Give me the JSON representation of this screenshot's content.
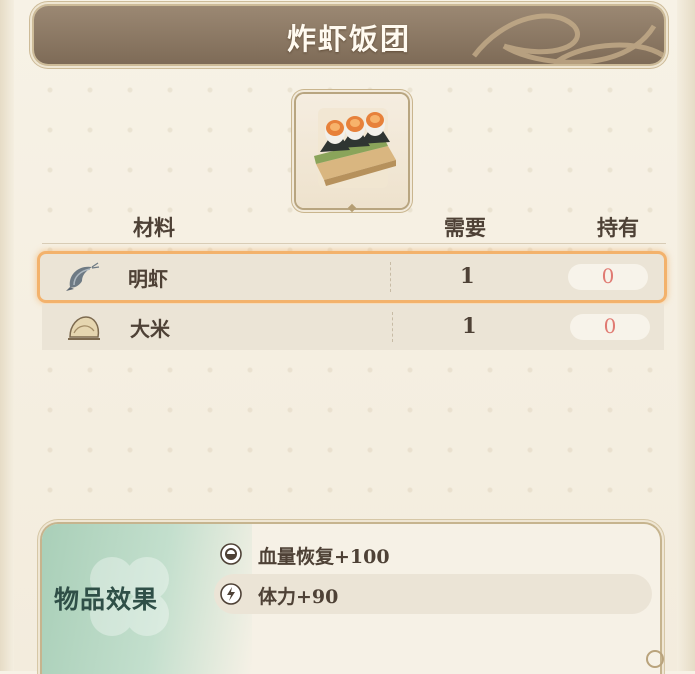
{
  "recipe": {
    "title": "炸虾饭团"
  },
  "item_icon": {
    "name": "fried-shrimp-rice-ball-icon"
  },
  "table": {
    "headers": {
      "material": "材料",
      "need": "需要",
      "own": "持有"
    },
    "rows": [
      {
        "name": "明虾",
        "icon": "shrimp-icon",
        "need": "1",
        "own": "0",
        "selected": true
      },
      {
        "name": "大米",
        "icon": "rice-sack-icon",
        "need": "1",
        "own": "0",
        "selected": false
      }
    ]
  },
  "effects": {
    "label": "物品效果",
    "items": [
      {
        "icon": "health-restore-icon",
        "text": "血量恢复+100"
      },
      {
        "icon": "stamina-icon",
        "text": "体力+90"
      }
    ]
  },
  "colors": {
    "title_bar": "#8c7964",
    "selection_glow": "#f3b26c",
    "own_value": "#e07a72",
    "effects_accent": "#a9cfb8"
  }
}
